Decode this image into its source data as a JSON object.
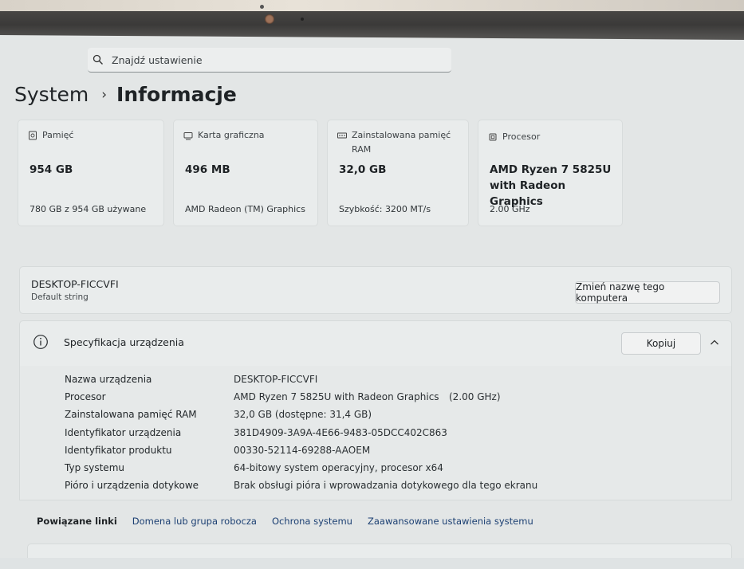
{
  "search": {
    "placeholder": "Znajdź ustawienie"
  },
  "breadcrumb": {
    "parent": "System",
    "separator": "›",
    "current": "Informacje"
  },
  "cards": [
    {
      "title": "Pamięć",
      "title2": "",
      "value": "954 GB",
      "value2": "",
      "sub": "780 GB z 954 GB używane",
      "icon": "storage-icon"
    },
    {
      "title": "Karta graficzna",
      "title2": "",
      "value": "496 MB",
      "value2": "",
      "sub": "AMD Radeon (TM) Graphics",
      "icon": "gpu-icon"
    },
    {
      "title": "Zainstalowana pamięć",
      "title2": "RAM",
      "value": "32,0 GB",
      "value2": "",
      "sub": "Szybkość: 3200 MT/s",
      "icon": "ram-icon"
    },
    {
      "title": "Procesor",
      "title2": "",
      "value": "AMD Ryzen 7 5825U",
      "value2": "with Radeon Graphics",
      "sub": "2.00 GHz",
      "icon": "processor-icon"
    }
  ],
  "device": {
    "name": "DESKTOP-FICCVFI",
    "subtitle": "Default string",
    "rename_label": "Zmień nazwę tego komputera"
  },
  "spec": {
    "title": "Specyfikacja urządzenia",
    "copy_label": "Kopiuj",
    "rows": [
      {
        "label": "Nazwa urządzenia",
        "value": "DESKTOP-FICCVFI",
        "extra": ""
      },
      {
        "label": "Procesor",
        "value": "AMD Ryzen 7 5825U with Radeon Graphics",
        "extra": "(2.00 GHz)"
      },
      {
        "label": "Zainstalowana pamięć RAM",
        "value": "32,0 GB (dostępne: 31,4 GB)",
        "extra": ""
      },
      {
        "label": "Identyfikator urządzenia",
        "value": "381D4909-3A9A-4E66-9483-05DCC402C863",
        "extra": ""
      },
      {
        "label": "Identyfikator produktu",
        "value": "00330-52114-69288-AAOEM",
        "extra": ""
      },
      {
        "label": "Typ systemu",
        "value": "64-bitowy system operacyjny, procesor x64",
        "extra": ""
      },
      {
        "label": "Pióro i urządzenia dotykowe",
        "value": "Brak obsługi pióra i wprowadzania dotykowego dla tego ekranu",
        "extra": ""
      }
    ]
  },
  "related": {
    "label": "Powiązane linki",
    "links": [
      "Domena lub grupa robocza",
      "Ochrona systemu",
      "Zaawansowane ustawienia systemu"
    ]
  }
}
